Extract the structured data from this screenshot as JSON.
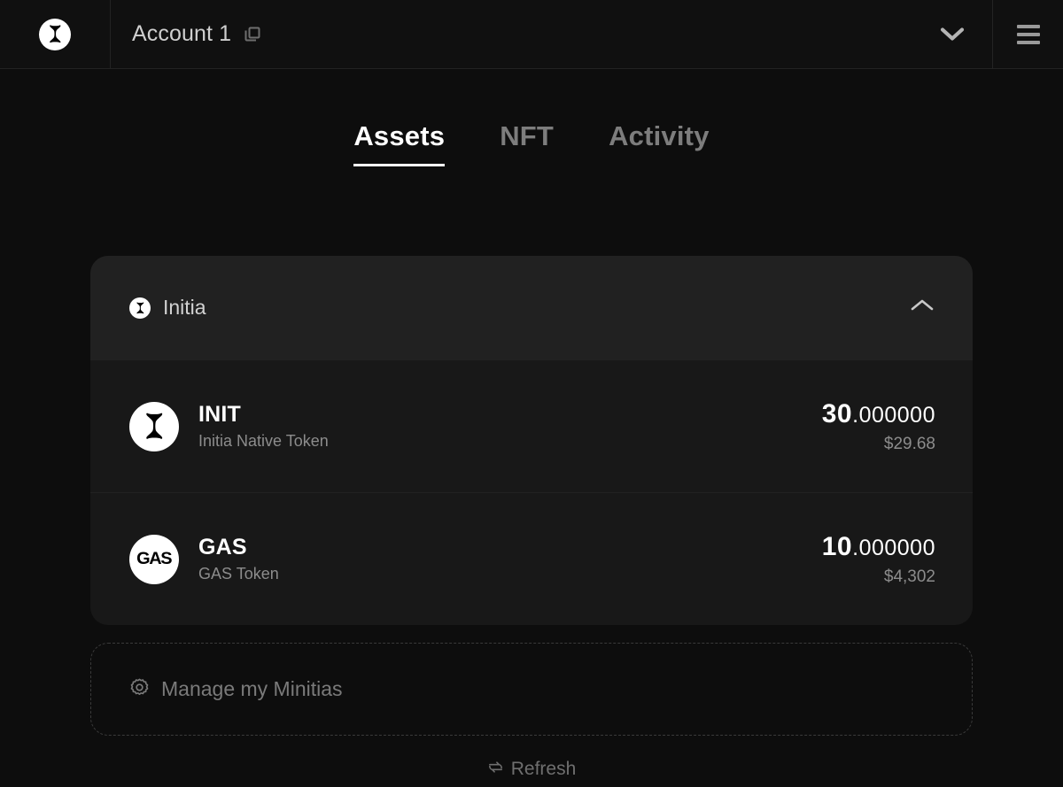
{
  "header": {
    "brand_icon": "initia-logo-icon",
    "account_name": "Account 1",
    "copy_icon": "copy-icon",
    "dropdown_icon": "chevron-down-icon",
    "menu_icon": "hamburger-menu-icon"
  },
  "tabs": [
    {
      "label": "Assets",
      "active": true
    },
    {
      "label": "NFT",
      "active": false
    },
    {
      "label": "Activity",
      "active": false
    }
  ],
  "chain_card": {
    "chain_name": "Initia",
    "chain_icon": "initia-logo-icon",
    "collapse_icon": "chevron-up-icon",
    "tokens": [
      {
        "icon": "initia-token-icon",
        "symbol": "INIT",
        "description": "Initia Native Token",
        "amount_int": "30",
        "amount_dec": ".000000",
        "fiat": "$29.68"
      },
      {
        "icon": "gas-token-icon",
        "symbol": "GAS",
        "description": "GAS Token",
        "amount_int": "10",
        "amount_dec": ".000000",
        "fiat": "$4,302"
      }
    ]
  },
  "manage_button": {
    "icon": "gear-icon",
    "label": "Manage my Minitias"
  },
  "refresh": {
    "icon": "refresh-icon",
    "label": "Refresh"
  },
  "colors": {
    "page_background": "#0d0d0d",
    "card_background": "#181818",
    "card_header_background": "#212121",
    "accent_text": "#ffffff",
    "muted_text": "#8c8c8c"
  }
}
